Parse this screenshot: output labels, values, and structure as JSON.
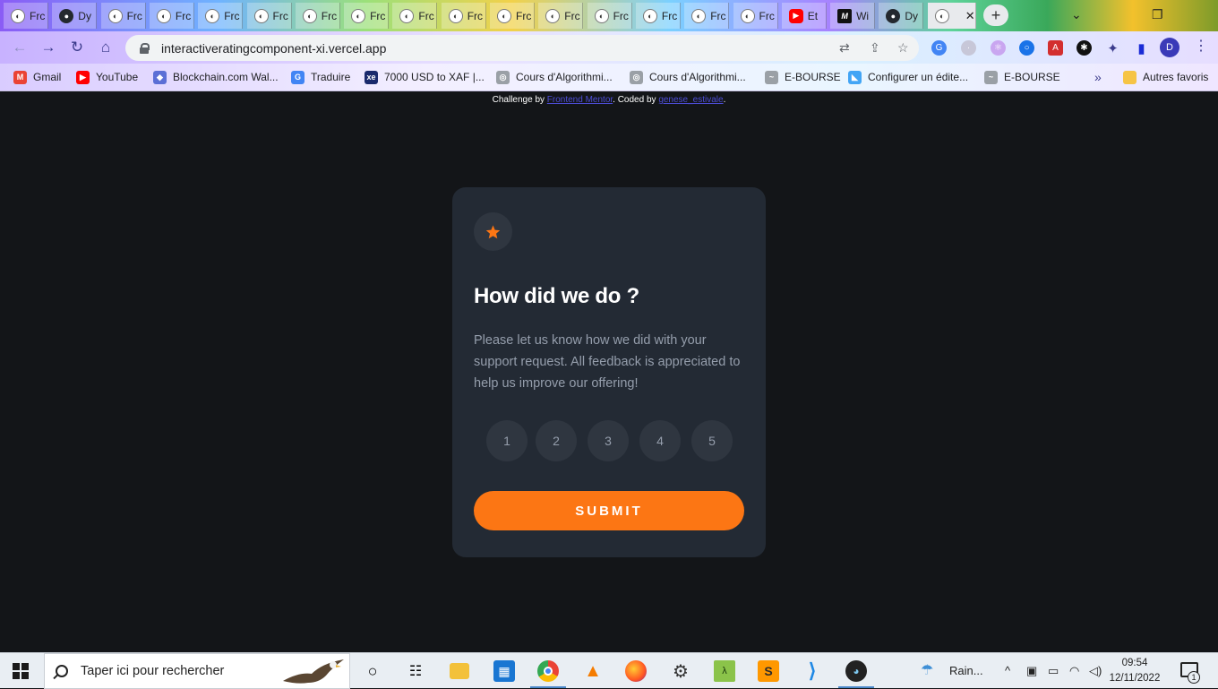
{
  "browser": {
    "tabs": [
      {
        "label": "Frc",
        "icon": "frontend-mentor-icon"
      },
      {
        "label": "Dy",
        "icon": "github-icon"
      },
      {
        "label": "Frc",
        "icon": "frontend-mentor-icon"
      },
      {
        "label": "Frc",
        "icon": "frontend-mentor-icon"
      },
      {
        "label": "Frc",
        "icon": "frontend-mentor-icon"
      },
      {
        "label": "Frc",
        "icon": "frontend-mentor-icon"
      },
      {
        "label": "Frc",
        "icon": "frontend-mentor-icon"
      },
      {
        "label": "Frc",
        "icon": "frontend-mentor-icon"
      },
      {
        "label": "Frc",
        "icon": "frontend-mentor-icon"
      },
      {
        "label": "Frc",
        "icon": "frontend-mentor-icon"
      },
      {
        "label": "Frc",
        "icon": "frontend-mentor-icon"
      },
      {
        "label": "Frc",
        "icon": "frontend-mentor-icon"
      },
      {
        "label": "Frc",
        "icon": "frontend-mentor-icon"
      },
      {
        "label": "Frc",
        "icon": "frontend-mentor-icon"
      },
      {
        "label": "Frc",
        "icon": "frontend-mentor-icon"
      },
      {
        "label": "Frc",
        "icon": "frontend-mentor-icon"
      },
      {
        "label": "Et",
        "icon": "youtube-icon"
      },
      {
        "label": "Wi",
        "icon": "medium-icon"
      },
      {
        "label": "Dy",
        "icon": "github-icon"
      },
      {
        "label": "",
        "icon": "frontend-mentor-icon",
        "active": true
      }
    ],
    "url": "interactiveratingcomponent-xi.vercel.app",
    "profile_initial": "D",
    "bookmarks": [
      {
        "label": "Gmail",
        "icon": "gmail-icon",
        "color": "#ea4335"
      },
      {
        "label": "YouTube",
        "icon": "youtube-icon",
        "color": "#ff0000"
      },
      {
        "label": "Blockchain.com Wal...",
        "icon": "blockchain-icon",
        "color": "#5b6fd6"
      },
      {
        "label": "Traduire",
        "icon": "google-translate-icon",
        "color": "#4285f4"
      },
      {
        "label": "7000 USD to XAF |...",
        "icon": "xe-icon",
        "color": "#1a2a6c"
      },
      {
        "label": "Cours d'Algorithmi...",
        "icon": "globe-icon",
        "color": "#9aa0a6"
      },
      {
        "label": "Cours d'Algorithmi...",
        "icon": "globe-icon",
        "color": "#9aa0a6"
      },
      {
        "label": "E-BOURSE",
        "icon": "bourse-icon",
        "color": "#9aa0a6"
      },
      {
        "label": "Configurer un édite...",
        "icon": "flutter-icon",
        "color": "#42a5f5"
      },
      {
        "label": "E-BOURSE",
        "icon": "bourse-icon",
        "color": "#9aa0a6"
      }
    ],
    "bookmarks_overflow": "»",
    "other_bookmarks": "Autres favoris"
  },
  "page": {
    "attribution": {
      "prefix": "Challenge by ",
      "link1": "Frontend Mentor",
      "middle": ". Coded by ",
      "link2": "genese_estivale",
      "suffix": "."
    },
    "card": {
      "title": "How did we do ?",
      "description": "Please let us know how we did with your support request. All feedback is appreciated to help us improve our offering!",
      "ratings": [
        "1",
        "2",
        "3",
        "4",
        "5"
      ],
      "submit_label": "SUBMIT",
      "accent_color": "#fc7614"
    }
  },
  "taskbar": {
    "search_placeholder": "Taper ici pour rechercher",
    "weather": "Rain...",
    "time": "09:54",
    "date": "12/11/2022",
    "notification_count": "1"
  }
}
